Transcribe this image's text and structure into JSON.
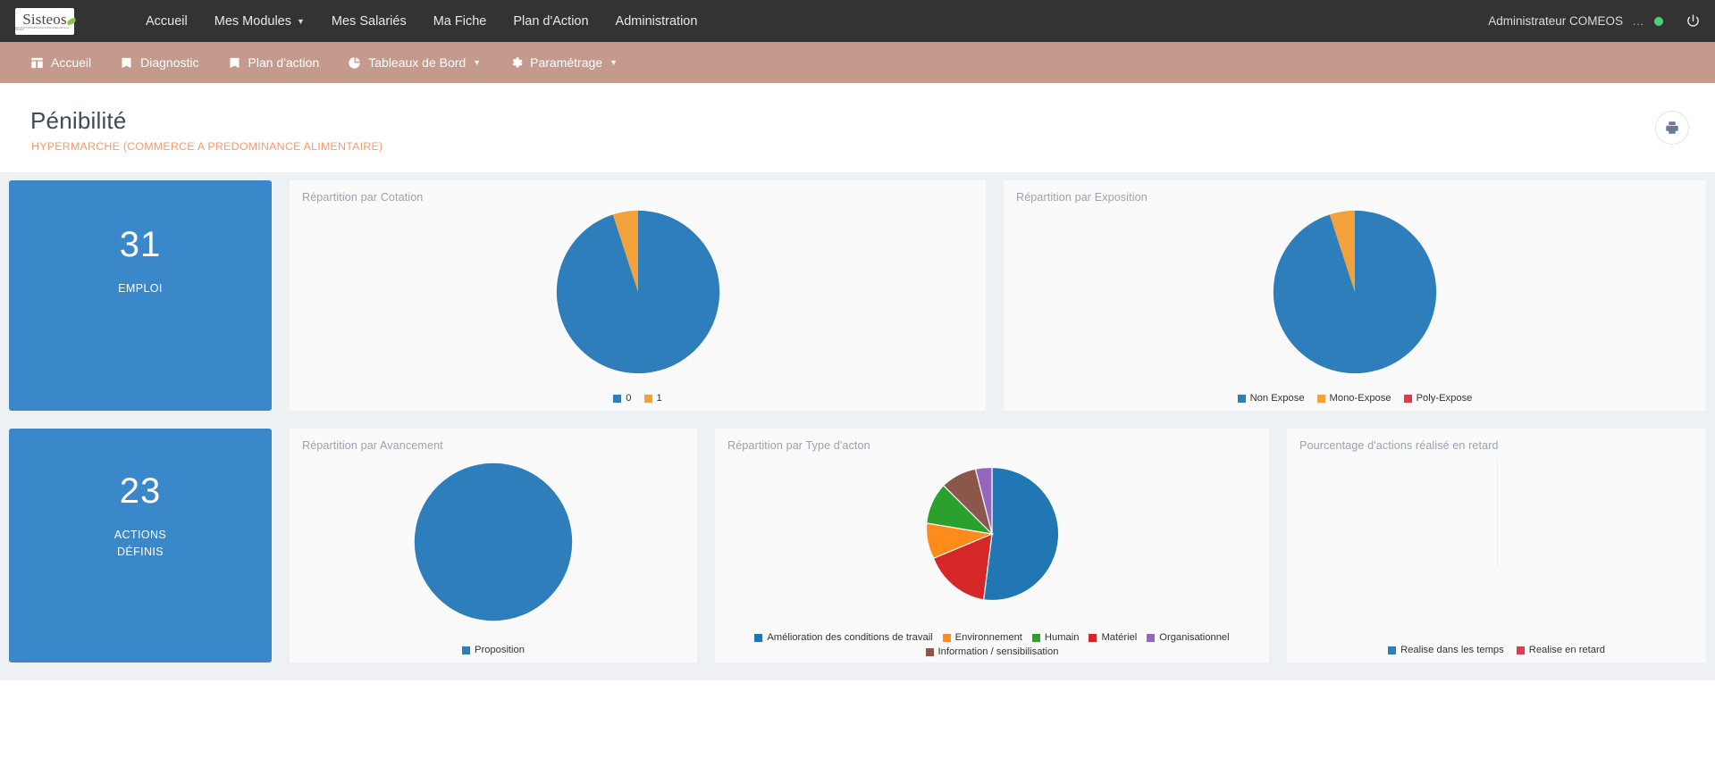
{
  "topnav": {
    "logo_text": "Sisteos",
    "logo_tagline": "SOLUTION INFORMATIQUE SANTE & SECURITE AU TRAVAIL",
    "items": [
      {
        "label": "Accueil",
        "has_caret": false
      },
      {
        "label": "Mes Modules",
        "has_caret": true
      },
      {
        "label": "Mes Salariés",
        "has_caret": false
      },
      {
        "label": "Ma Fiche",
        "has_caret": false
      },
      {
        "label": "Plan d'Action",
        "has_caret": false
      },
      {
        "label": "Administration",
        "has_caret": false
      }
    ],
    "user": "Administrateur COMEOS",
    "overflow": "...",
    "status_color": "#4cd07d",
    "power_label": "power-off"
  },
  "subnav": {
    "bg_color": "#c39a8c",
    "items": [
      {
        "label": "Accueil",
        "icon": "dashboard-icon",
        "has_caret": false
      },
      {
        "label": "Diagnostic",
        "icon": "book-icon",
        "has_caret": false
      },
      {
        "label": "Plan d'action",
        "icon": "book-icon",
        "has_caret": false
      },
      {
        "label": "Tableaux de Bord",
        "icon": "pie-chart-icon",
        "has_caret": true
      },
      {
        "label": "Paramétrage",
        "icon": "gear-icon",
        "has_caret": true
      }
    ]
  },
  "page": {
    "title": "Pénibilité",
    "subtitle": "HYPERMARCHE (COMMERCE A PREDOMINANCE ALIMENTAIRE)",
    "subtitle_color": "#f79a6a",
    "print_button": "print-icon"
  },
  "stats": [
    {
      "value": "31",
      "label": "EMPLOI",
      "color": "#3a88c9"
    },
    {
      "value": "23",
      "label": "ACTIONS\nDÉFINIS",
      "label_line1": "ACTIONS",
      "label_line2": "DÉFINIS",
      "color": "#3a88c9"
    }
  ],
  "chart_data": [
    {
      "type": "pie",
      "id": "repartition-par-cotation",
      "title": "Répartition par Cotation",
      "categories": [
        "0",
        "1"
      ],
      "values": [
        90,
        10
      ],
      "colors": [
        "#2e7ebb",
        "#f2a13b"
      ],
      "legend_position": "bottom",
      "start_angle_deg": 0
    },
    {
      "type": "pie",
      "id": "repartition-par-exposition",
      "title": "Répartition par Exposition",
      "categories": [
        "Non Expose",
        "Mono-Expose",
        "Poly-Expose"
      ],
      "values": [
        90,
        10,
        0
      ],
      "colors": [
        "#2e7ebb",
        "#f2a13b",
        "#dc3d4a"
      ],
      "legend_position": "bottom",
      "start_angle_deg": 0
    },
    {
      "type": "pie",
      "id": "repartition-par-avancement",
      "title": "Répartition par Avancement",
      "categories": [
        "Proposition"
      ],
      "values": [
        100
      ],
      "colors": [
        "#2e7ebb"
      ],
      "legend_position": "bottom",
      "start_angle_deg": 0
    },
    {
      "type": "pie",
      "id": "repartition-par-type-daction",
      "title": "Répartition par Type d'acton",
      "categories": [
        "Amélioration des conditions de travail",
        "Environnement",
        "Humain",
        "Matériel",
        "Organisationnel",
        "Information / sensibilisation"
      ],
      "values": [
        52,
        10,
        9,
        17,
        4,
        8
      ],
      "colors": [
        "#2077b4",
        "#ff8c1a",
        "#2ca02c",
        "#d62728",
        "#9467bd",
        "#8c564b"
      ],
      "slice_order": [
        "Amélioration des conditions de travail",
        "Matériel",
        "Environnement",
        "Humain",
        "Information / sensibilisation",
        "Organisationnel"
      ],
      "legend_position": "bottom",
      "start_angle_deg": 0
    },
    {
      "type": "pie",
      "id": "pourcentage-actions-realise-en-retard",
      "title": "Pourcentage d'actions réalisé en retard",
      "categories": [
        "Realise dans les temps",
        "Realise en retard"
      ],
      "values": [
        0,
        0
      ],
      "colors": [
        "#2e7ebb",
        "#dc3d4a"
      ],
      "legend_position": "bottom",
      "empty": true
    }
  ]
}
